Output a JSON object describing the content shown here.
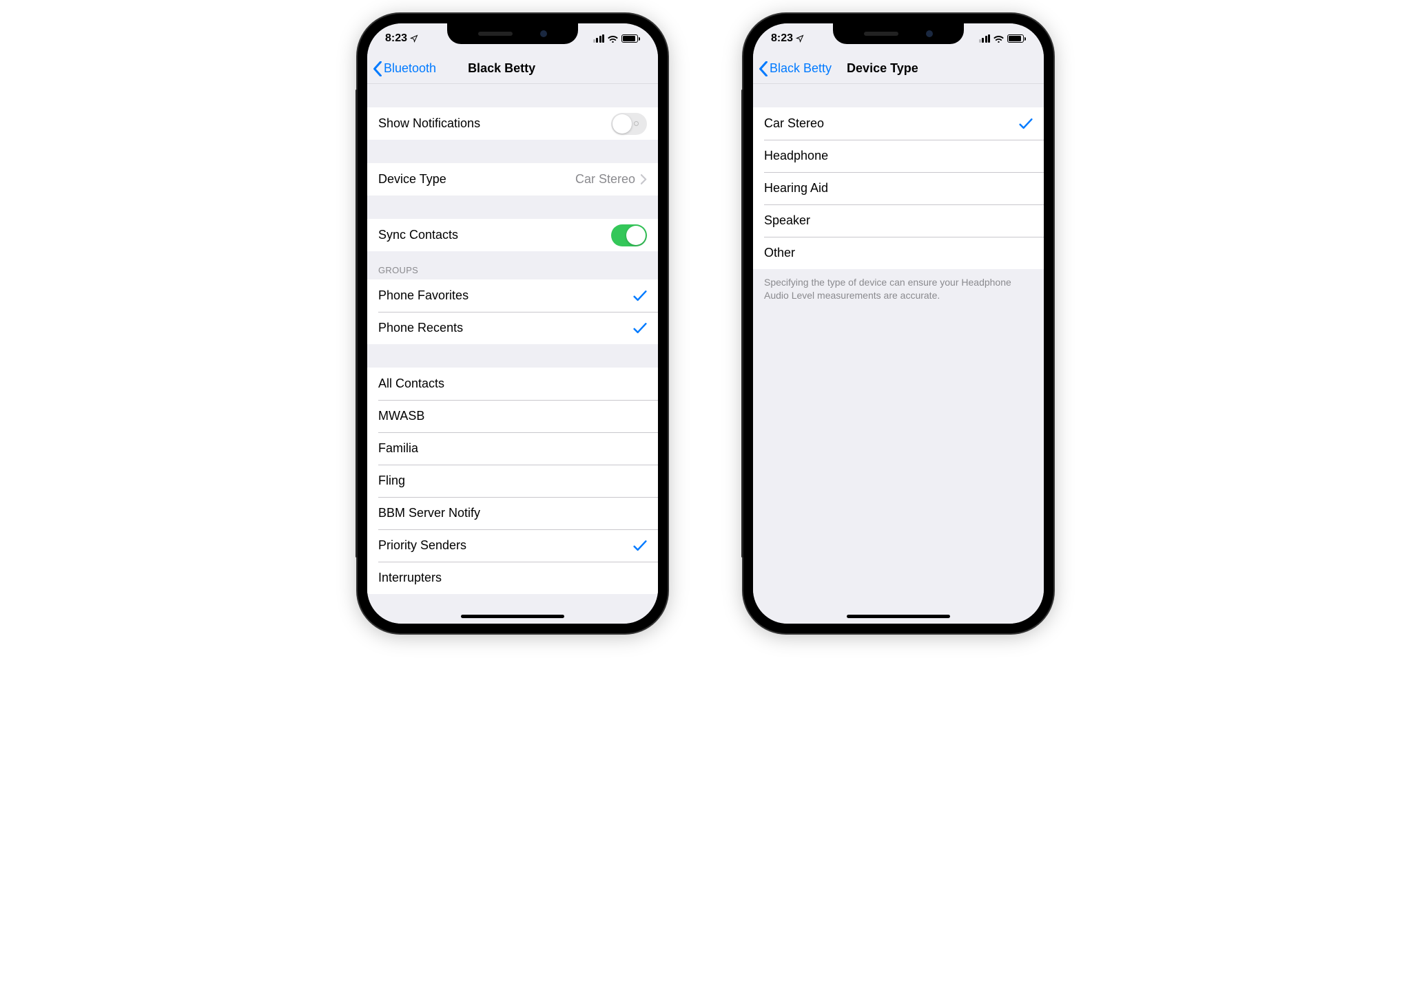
{
  "status": {
    "time": "8:23"
  },
  "phone1": {
    "back_label": "Bluetooth",
    "title": "Black Betty",
    "show_notifications": {
      "label": "Show Notifications",
      "on": false
    },
    "device_type": {
      "label": "Device Type",
      "value": "Car Stereo"
    },
    "sync_contacts": {
      "label": "Sync Contacts",
      "on": true
    },
    "groups_header": "GROUPS",
    "groups": [
      {
        "label": "Phone Favorites",
        "checked": true
      },
      {
        "label": "Phone Recents",
        "checked": true
      }
    ],
    "contacts": [
      {
        "label": "All Contacts",
        "checked": false
      },
      {
        "label": "MWASB",
        "checked": false
      },
      {
        "label": "Familia",
        "checked": false
      },
      {
        "label": "Fling",
        "checked": false
      },
      {
        "label": "BBM Server Notify",
        "checked": false
      },
      {
        "label": "Priority Senders",
        "checked": true
      },
      {
        "label": "Interrupters",
        "checked": false
      }
    ]
  },
  "phone2": {
    "back_label": "Black Betty",
    "title": "Device Type",
    "options": [
      {
        "label": "Car Stereo",
        "checked": true
      },
      {
        "label": "Headphone",
        "checked": false
      },
      {
        "label": "Hearing Aid",
        "checked": false
      },
      {
        "label": "Speaker",
        "checked": false
      },
      {
        "label": "Other",
        "checked": false
      }
    ],
    "footer": "Specifying the type of device can ensure your Headphone Audio Level measurements are accurate."
  }
}
